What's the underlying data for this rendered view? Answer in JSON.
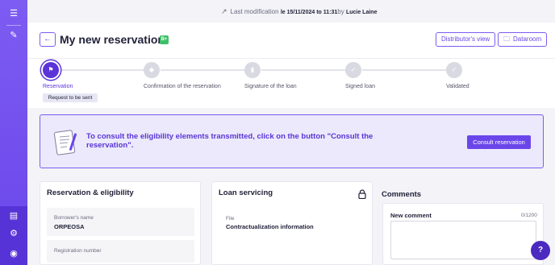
{
  "sidebar": {
    "icons": [
      {
        "name": "menu-icon",
        "glyph": "☰"
      },
      {
        "name": "notes-icon",
        "glyph": "✎"
      },
      {
        "name": "book-icon",
        "glyph": "▤"
      },
      {
        "name": "settings-icon",
        "glyph": "⚙"
      },
      {
        "name": "user-icon",
        "glyph": "◉"
      }
    ],
    "colors": {
      "gradient_top": "#7d5cf2",
      "gradient_bottom": "#6a46ea",
      "bottom": "#5633d6"
    }
  },
  "topbar": {
    "icon": "trending-up-icon",
    "label": "Last modification",
    "date": "le 15/11/2024 to 11:31",
    "by": "by",
    "user": "Lucie Laine"
  },
  "header": {
    "back_icon": "arrow-left-icon",
    "title": "My new reservation",
    "badge": "B+",
    "distributor_view": "Distributor's view",
    "dataroom": "Dataroom",
    "dataroom_icon": "folder-icon"
  },
  "stepper": {
    "steps": [
      {
        "label": "Reservation",
        "icon": "flag-icon",
        "glyph": "⚑",
        "active": true
      },
      {
        "label": "Confirmation of the reservation",
        "icon": "tag-icon",
        "glyph": "◆",
        "active": false
      },
      {
        "label": "Signature of the loan",
        "icon": "document-icon",
        "glyph": "▮",
        "active": false
      },
      {
        "label": "Signed loan",
        "icon": "check-icon",
        "glyph": "✓",
        "active": false
      },
      {
        "label": "Validated",
        "icon": "check-icon",
        "glyph": "✓",
        "active": false
      }
    ],
    "status_badge": "Request to be sent"
  },
  "banner": {
    "text": "To consult the eligibility elements transmitted, click on the button \"Consult the reservation\".",
    "button": "Consult reservation",
    "illustration": "document-illustration-icon"
  },
  "reservation_card": {
    "title": "Reservation & eligibility",
    "fields": [
      {
        "label": "Borrower's name",
        "value": "ORPEOSA"
      },
      {
        "label": "Registration number",
        "value": ""
      }
    ]
  },
  "loan_card": {
    "title": "Loan servicing",
    "lock_icon": "lock-icon",
    "fields": [
      {
        "label": "File",
        "value": "Contractualization information"
      }
    ]
  },
  "comments": {
    "title": "Comments",
    "new_comment_label": "New comment",
    "counter": "0/1200",
    "placeholder": ""
  },
  "help": {
    "glyph": "?",
    "icon": "help-icon"
  },
  "colors": {
    "accent": "#6a46ea",
    "accent_dark": "#5a34d6",
    "success": "#3fbf6a",
    "banner_bg": "#ebe9fb"
  }
}
